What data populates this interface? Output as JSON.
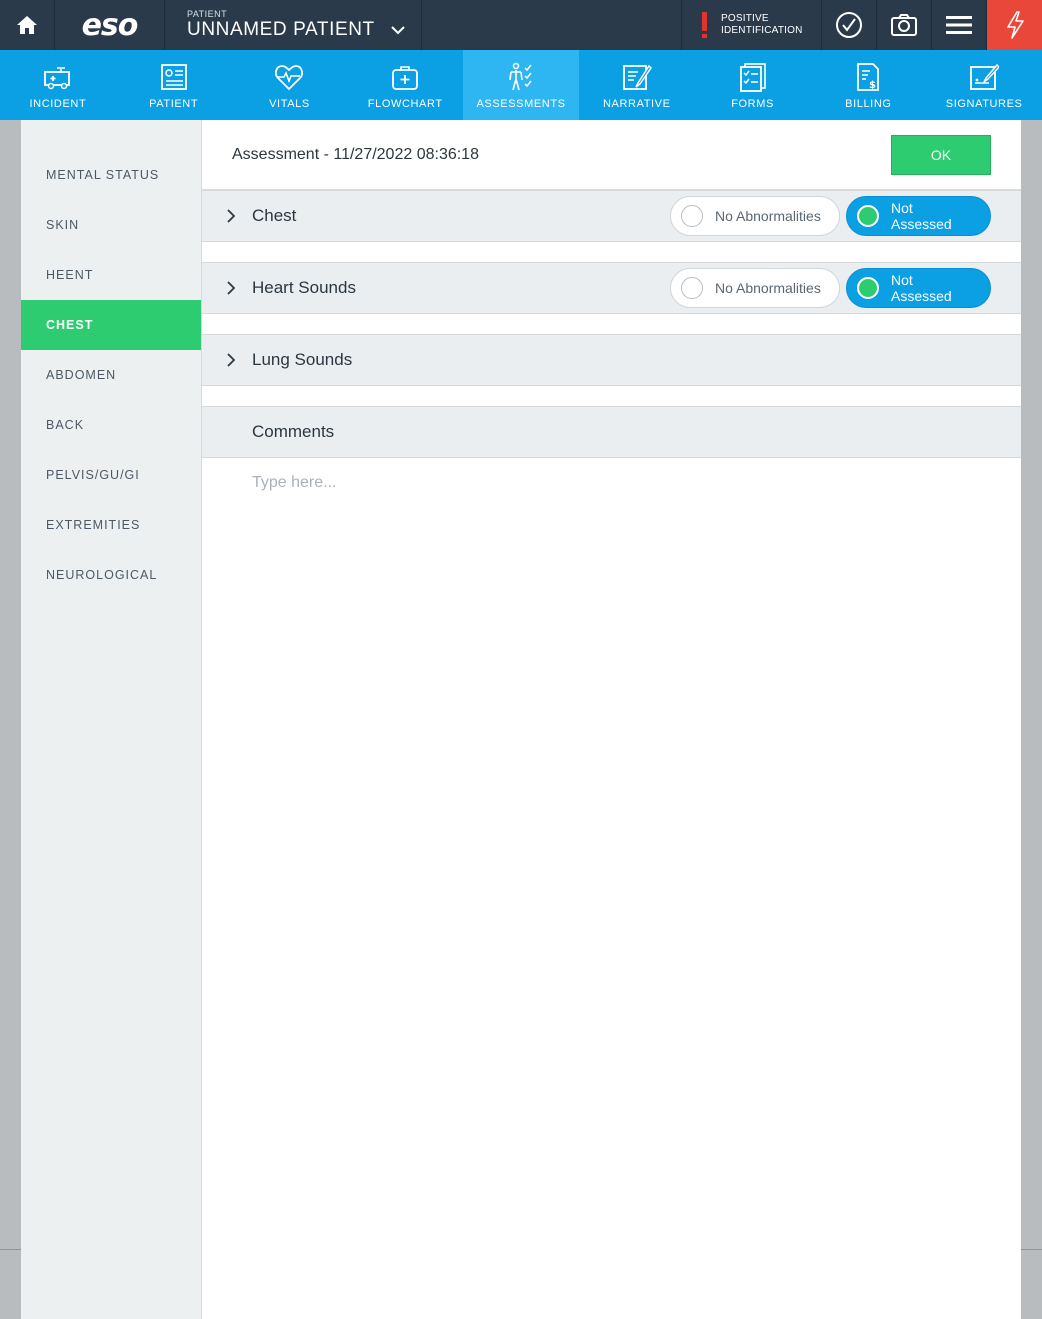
{
  "topbar": {
    "home_icon": "home-icon",
    "logo": "eso",
    "patient_label": "PATIENT",
    "patient_name": "UNNAMED PATIENT",
    "positive_id_line1": "POSITIVE",
    "positive_id_line2": "IDENTIFICATION",
    "icons": [
      "check-circle-icon",
      "camera-icon",
      "menu-icon",
      "flash-icon"
    ],
    "flash_color": "#e8473a"
  },
  "nav": {
    "items": [
      {
        "label": "INCIDENT",
        "icon": "ambulance-icon"
      },
      {
        "label": "PATIENT",
        "icon": "patient-card-icon"
      },
      {
        "label": "VITALS",
        "icon": "heartbeat-icon"
      },
      {
        "label": "FLOWCHART",
        "icon": "medical-bag-icon"
      },
      {
        "label": "ASSESSMENTS",
        "icon": "body-check-icon"
      },
      {
        "label": "NARRATIVE",
        "icon": "narrative-pen-icon"
      },
      {
        "label": "FORMS",
        "icon": "forms-checklist-icon"
      },
      {
        "label": "BILLING",
        "icon": "billing-document-icon"
      },
      {
        "label": "SIGNATURES",
        "icon": "signature-icon"
      }
    ],
    "active": "ASSESSMENTS",
    "color": "#0b9fe4"
  },
  "sidebar": {
    "items": [
      {
        "label": "MENTAL STATUS"
      },
      {
        "label": "SKIN"
      },
      {
        "label": "HEENT"
      },
      {
        "label": "CHEST"
      },
      {
        "label": "ABDOMEN"
      },
      {
        "label": "BACK"
      },
      {
        "label": "PELVIS/GU/GI"
      },
      {
        "label": "EXTREMITIES"
      },
      {
        "label": "NEUROLOGICAL"
      }
    ],
    "active": "CHEST",
    "active_color": "#2ecc71"
  },
  "main": {
    "title": "Assessment - 11/27/2022 08:36:18",
    "ok_label": "OK",
    "sections": [
      {
        "title": "Chest",
        "no_abn_label": "No Abnormalities",
        "not_assessed_label": "Not Assessed",
        "selected": "Not Assessed"
      },
      {
        "title": "Heart Sounds",
        "no_abn_label": "No Abnormalities",
        "not_assessed_label": "Not Assessed",
        "selected": "Not Assessed"
      },
      {
        "title": "Lung Sounds"
      }
    ],
    "comments": {
      "title": "Comments",
      "placeholder": "Type here..."
    }
  }
}
